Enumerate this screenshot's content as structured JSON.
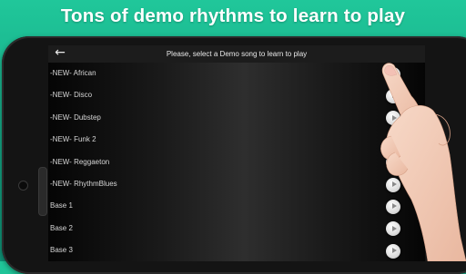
{
  "headline": "Tons of demo rhythms to learn to play",
  "appbar": {
    "back_icon": "arrow-left-icon",
    "title": "Please, select a Demo song to learn to play"
  },
  "songs": [
    {
      "label": "-NEW- African"
    },
    {
      "label": "-NEW- Disco"
    },
    {
      "label": "-NEW- Dubstep"
    },
    {
      "label": "-NEW- Funk 2"
    },
    {
      "label": "-NEW- Reggaeton"
    },
    {
      "label": "-NEW- RhythmBlues"
    },
    {
      "label": "Base 1"
    },
    {
      "label": "Base 2"
    },
    {
      "label": "Base 3"
    }
  ],
  "colors": {
    "background": "#14a583",
    "phone_body": "#141414",
    "screen": "#0d0d0d",
    "text": "#d6d6d6"
  }
}
